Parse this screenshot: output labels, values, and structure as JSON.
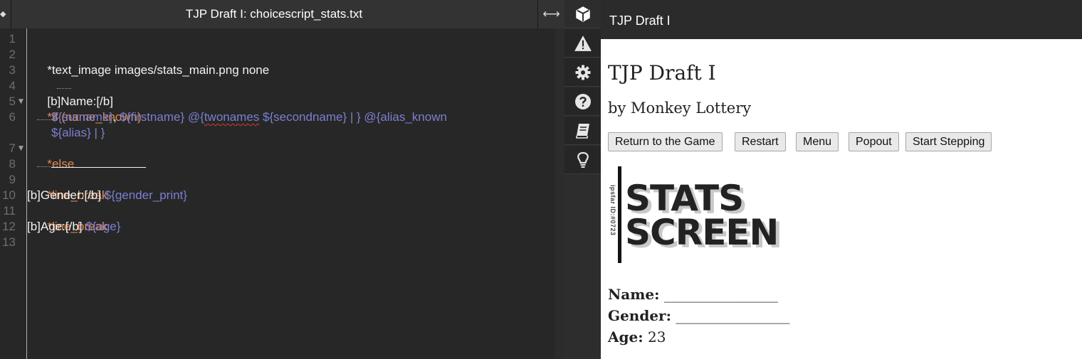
{
  "editor": {
    "title": "TJP Draft I: choicescript_stats.txt",
    "lines": {
      "l2": "*text_image images/stats_main.png none",
      "l4": "[b]Name:[/b]",
      "l5": "*if (name_known)",
      "l6a_surname": "${surname}",
      "l6a_comma": ", ",
      "l6a_firstname": "${firstname}",
      "l6a_at": " @{",
      "l6a_twonames": "twonames",
      "l6a_rest": " ${secondname} | } @{alias_known",
      "l6b": "${alias} | }",
      "l7": "*else",
      "l9": "*line_break",
      "l10_text": "[b]Gender:[/b] ",
      "l10_var": "${gender_print}",
      "l11": "*line_break",
      "l12_text": "[b]Age:[/b] ",
      "l12_var": "${age}"
    },
    "line_numbers": [
      "1",
      "2",
      "3",
      "4",
      "5",
      "6",
      "7",
      "8",
      "9",
      "10",
      "11",
      "12",
      "13"
    ]
  },
  "toolbar": {
    "tools": [
      "cube-icon",
      "warning-icon",
      "gear-icon",
      "help-icon",
      "book-icon",
      "lightbulb-icon"
    ]
  },
  "preview": {
    "header_title": "TJP Draft I",
    "game_title": "TJP Draft I",
    "author": "by Monkey Lottery",
    "buttons": {
      "return": "Return to the Game",
      "restart": "Restart",
      "menu": "Menu",
      "popout": "Popout",
      "start_stepping": "Start Stepping"
    },
    "banner": {
      "line1": "STATS",
      "line2": "SCREEN",
      "vertical_text": "ipsfar ID:#0723"
    },
    "stats": {
      "name_label": "Name:",
      "name_value": " ________________",
      "gender_label": "Gender:",
      "gender_value": " ________________",
      "age_label": "Age:",
      "age_value": " 23"
    }
  },
  "colors": {
    "editor_bg": "#272727",
    "command": "#e08a55",
    "variable": "#7c7fd1",
    "plain_text": "#f2f2f2"
  }
}
